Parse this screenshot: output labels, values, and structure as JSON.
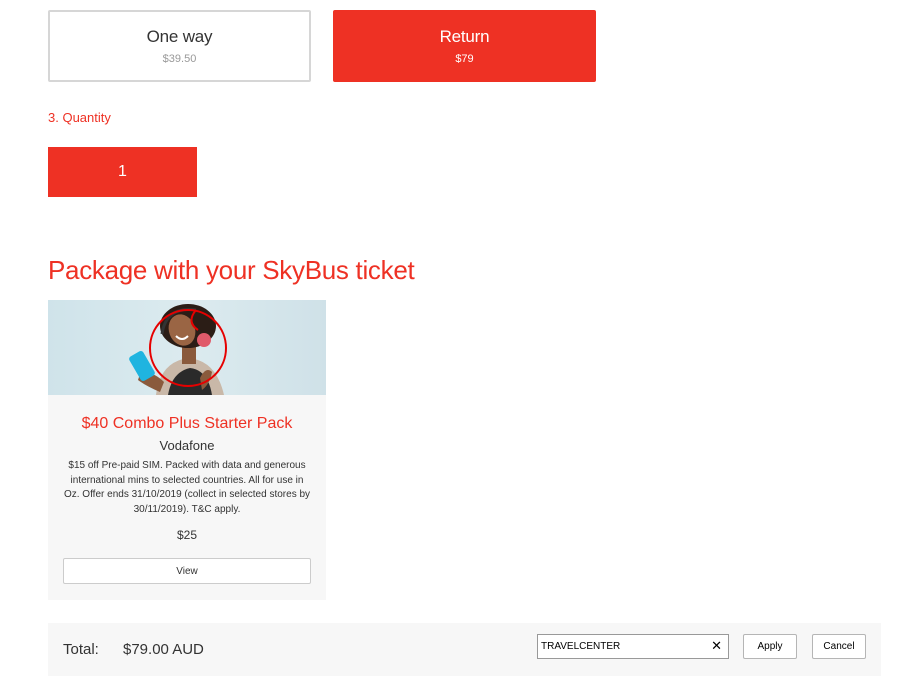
{
  "fares": {
    "one_way": {
      "label": "One way",
      "price": "$39.50"
    },
    "return": {
      "label": "Return",
      "price": "$79"
    }
  },
  "quantity": {
    "label": "3. Quantity",
    "value": "1"
  },
  "package_section": {
    "title": "Package with your SkyBus ticket"
  },
  "package_card": {
    "title": "$40 Combo Plus Starter Pack",
    "vendor": "Vodafone",
    "description": "$15 off Pre-paid SIM. Packed with data and generous international mins to selected countries. All for use in Oz. Offer ends 31/10/2019 (collect in selected stores by 30/11/2019). T&C apply.",
    "price": "$25",
    "view_label": "View",
    "image_icon": "vodafone-promo-photo"
  },
  "total_bar": {
    "label": "Total:",
    "value": "$79.00 AUD",
    "promo_value": "TRAVELCENTER",
    "clear_icon": "✕",
    "apply_label": "Apply",
    "cancel_label": "Cancel"
  },
  "colors": {
    "accent": "#ee3124",
    "card_bg": "#f7f7f7",
    "border": "#d6d6d6"
  }
}
